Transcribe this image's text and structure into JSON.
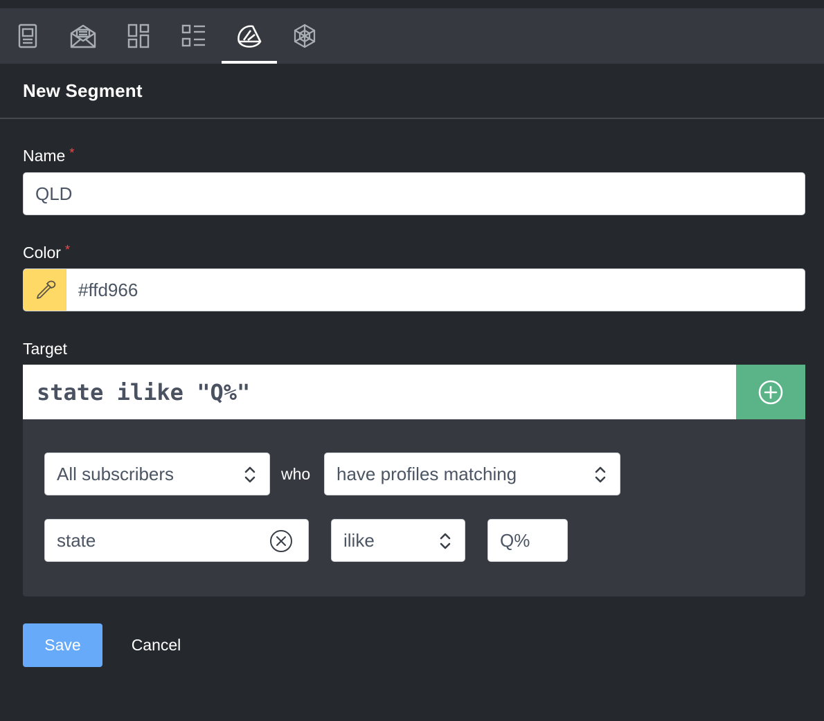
{
  "tabs": [
    {
      "icon": "document-icon",
      "active": false
    },
    {
      "icon": "mail-open-icon",
      "active": false
    },
    {
      "icon": "dashboard-icon",
      "active": false
    },
    {
      "icon": "list-icon",
      "active": false
    },
    {
      "icon": "segment-icon",
      "active": true
    },
    {
      "icon": "atom-icon",
      "active": false
    }
  ],
  "header": {
    "title": "New Segment"
  },
  "form": {
    "name_label": "Name",
    "name_required": "*",
    "name_value": "QLD",
    "color_label": "Color",
    "color_required": "*",
    "color_value": "#ffd966",
    "target_label": "Target"
  },
  "target": {
    "expression": "state ilike \"Q%\""
  },
  "builder": {
    "audience": "All subscribers",
    "who": "who",
    "condition": "have profiles matching",
    "field": "state",
    "operator": "ilike",
    "value": "Q%"
  },
  "actions": {
    "save_label": "Save",
    "cancel_label": "Cancel"
  },
  "colors": {
    "swatch": "#ffd966",
    "add_button": "#5ab488",
    "save_button": "#66aaf9",
    "required": "#ef4b4b"
  }
}
